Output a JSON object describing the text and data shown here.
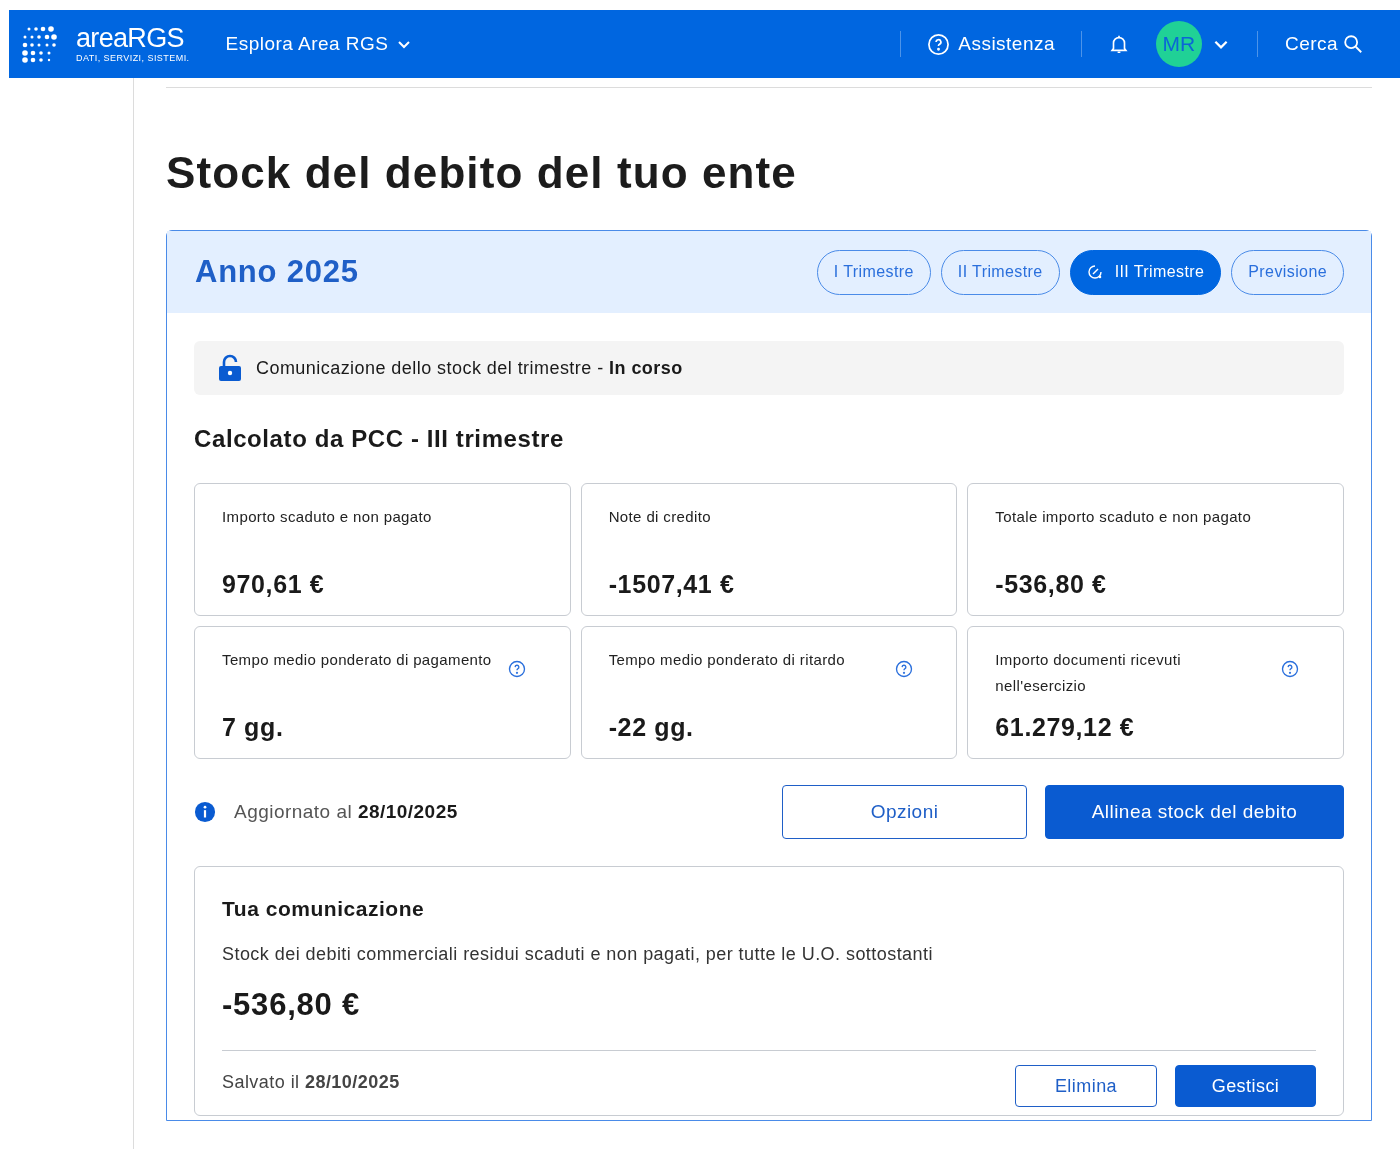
{
  "header": {
    "logo_name": "areaRGS",
    "logo_tagline": "DATI, SERVIZI, SISTEMI.",
    "explore": "Esplora Area RGS",
    "help": "Assistenza",
    "avatar": "MR",
    "search": "Cerca"
  },
  "title": "Stock del debito del tuo ente",
  "year_card": {
    "year": "Anno 2025",
    "tabs": [
      {
        "label": "I Trimestre",
        "selected": false,
        "icon": false
      },
      {
        "label": "II Trimestre",
        "selected": false,
        "icon": false
      },
      {
        "label": "III Trimestre",
        "selected": true,
        "icon": true
      },
      {
        "label": "Previsione",
        "selected": false,
        "icon": false
      }
    ],
    "status": {
      "text": "Comunicazione dello stock del trimestre - **In corso**"
    },
    "section_title": "Calcolato da PCC - III trimestre",
    "metrics": [
      {
        "label": "Importo scaduto e non pagato",
        "value": "970,61 €",
        "help": false
      },
      {
        "label": "Note di credito",
        "value": "-1507,41 €",
        "help": false
      },
      {
        "label": "Totale importo scaduto e non pagato",
        "value": "-536,80 €",
        "help": false
      },
      {
        "label": "Tempo medio ponderato di pagamento",
        "value": "7 gg.",
        "help": true
      },
      {
        "label": "Tempo medio ponderato di ritardo",
        "value": "-22 gg.",
        "help": true
      },
      {
        "label": "Importo documenti ricevuti nell'esercizio",
        "value": "61.279,12 €",
        "help": true
      }
    ],
    "updated": "Aggiornato al **28/10/2025**",
    "buttons": [
      {
        "label": "Opzioni",
        "kind": "outline"
      },
      {
        "label": "Allinea stock del debito",
        "kind": "primary"
      }
    ],
    "communication": {
      "title": "Tua comunicazione",
      "description": "Stock dei debiti commerciali residui scaduti e non pagati, per tutte le U.O. sottostanti",
      "amount": "-536,80 €",
      "saved": "Salvato il **28/10/2025**",
      "buttons": [
        {
          "label": "Elimina",
          "kind": "outline"
        },
        {
          "label": "Gestisci",
          "kind": "primary"
        }
      ]
    }
  }
}
